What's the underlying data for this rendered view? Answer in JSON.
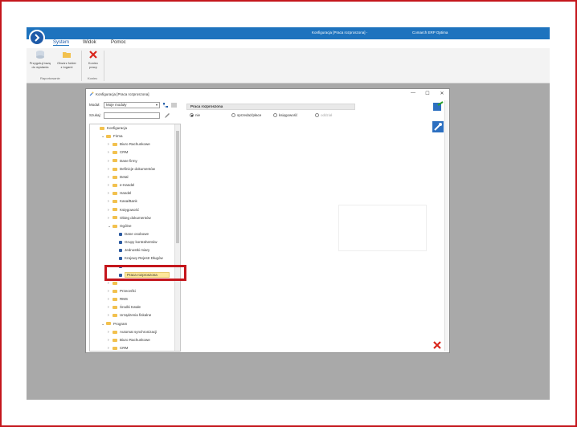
{
  "app": {
    "title_center": "Konfiguracja [Praca rozproszona] -",
    "title_right": "Comarch ERP Optima"
  },
  "menu": [
    {
      "label": "System",
      "active": true
    },
    {
      "label": "Widok",
      "active": false
    },
    {
      "label": "Pomoc",
      "active": false
    }
  ],
  "ribbon": {
    "btn_upgrade_l1": "Przygotuj bazę",
    "btn_upgrade_l2": "do wysłania",
    "btn_logs_l1": "Otwórz folder",
    "btn_logs_l2": "z logami",
    "btn_end_l1": "Koniec",
    "btn_end_l2": "pracy",
    "group1": "Raportowanie",
    "group2": "Koniec"
  },
  "window": {
    "title": "Konfiguracja [Praca rozproszona]",
    "modul_label": "Moduł:",
    "modul_value": "Moje moduły",
    "szukaj_label": "Szukaj:"
  },
  "tree": [
    {
      "label": "Konfiguracja",
      "level": 0,
      "type": "folder",
      "chev": ""
    },
    {
      "label": "Firma",
      "level": 1,
      "type": "folder",
      "chev": "v"
    },
    {
      "label": "Biuro Rachunkowe",
      "level": 2,
      "type": "folder",
      "chev": ">"
    },
    {
      "label": "CRM",
      "level": 2,
      "type": "folder",
      "chev": ">"
    },
    {
      "label": "Dane firmy",
      "level": 2,
      "type": "folder",
      "chev": ">"
    },
    {
      "label": "Definicje dokumentów",
      "level": 2,
      "type": "folder",
      "chev": ">"
    },
    {
      "label": "Detal",
      "level": 2,
      "type": "folder",
      "chev": ">"
    },
    {
      "label": "e-Handel",
      "level": 2,
      "type": "folder",
      "chev": ">"
    },
    {
      "label": "Handel",
      "level": 2,
      "type": "folder",
      "chev": ">"
    },
    {
      "label": "Kasa/Bank",
      "level": 2,
      "type": "folder",
      "chev": ">"
    },
    {
      "label": "Księgowość",
      "level": 2,
      "type": "folder",
      "chev": ">"
    },
    {
      "label": "Obieg dokumentów",
      "level": 2,
      "type": "folder",
      "chev": ">"
    },
    {
      "label": "Ogólne",
      "level": 2,
      "type": "folder",
      "chev": "v"
    },
    {
      "label": "Dane osobowe",
      "level": 3,
      "type": "leaf",
      "chev": ""
    },
    {
      "label": "Grupy kontrahentów",
      "level": 3,
      "type": "leaf",
      "chev": ""
    },
    {
      "label": "Jednostki miary",
      "level": 3,
      "type": "leaf",
      "chev": ""
    },
    {
      "label": "Krajowy Rejestr Długów",
      "level": 3,
      "type": "leaf",
      "chev": ""
    },
    {
      "label": "",
      "level": 3,
      "type": "leaf",
      "chev": ""
    },
    {
      "label": "Praca rozproszona",
      "level": 3,
      "type": "leaf",
      "chev": "",
      "selected": true
    },
    {
      "label": "",
      "level": 2,
      "type": "folder",
      "chev": ">"
    },
    {
      "label": "Przeceńki",
      "level": 2,
      "type": "folder",
      "chev": ">"
    },
    {
      "label": "RMS",
      "level": 2,
      "type": "folder",
      "chev": ">"
    },
    {
      "label": "Środki trwałe",
      "level": 2,
      "type": "folder",
      "chev": ">"
    },
    {
      "label": "Urządzenia fiskalne",
      "level": 2,
      "type": "folder",
      "chev": ">"
    },
    {
      "label": "Program",
      "level": 1,
      "type": "folder",
      "chev": "v"
    },
    {
      "label": "Automat synchronizacji",
      "level": 2,
      "type": "folder",
      "chev": ">"
    },
    {
      "label": "Biuro Rachunkowe",
      "level": 2,
      "type": "folder",
      "chev": ">"
    },
    {
      "label": "CRM",
      "level": 2,
      "type": "folder",
      "chev": ">"
    }
  ],
  "panel": {
    "header": "Praca rozproszona",
    "options": [
      {
        "label": "nie",
        "checked": true,
        "disabled": false
      },
      {
        "label": "sprzedaż/płace",
        "checked": false,
        "disabled": false
      },
      {
        "label": "księgowość",
        "checked": false,
        "disabled": false
      },
      {
        "label": "oddział",
        "checked": false,
        "disabled": true
      }
    ]
  },
  "colors": {
    "titlebar": "#1e73be",
    "highlight": "#c4161c",
    "selection": "#fde79a"
  }
}
